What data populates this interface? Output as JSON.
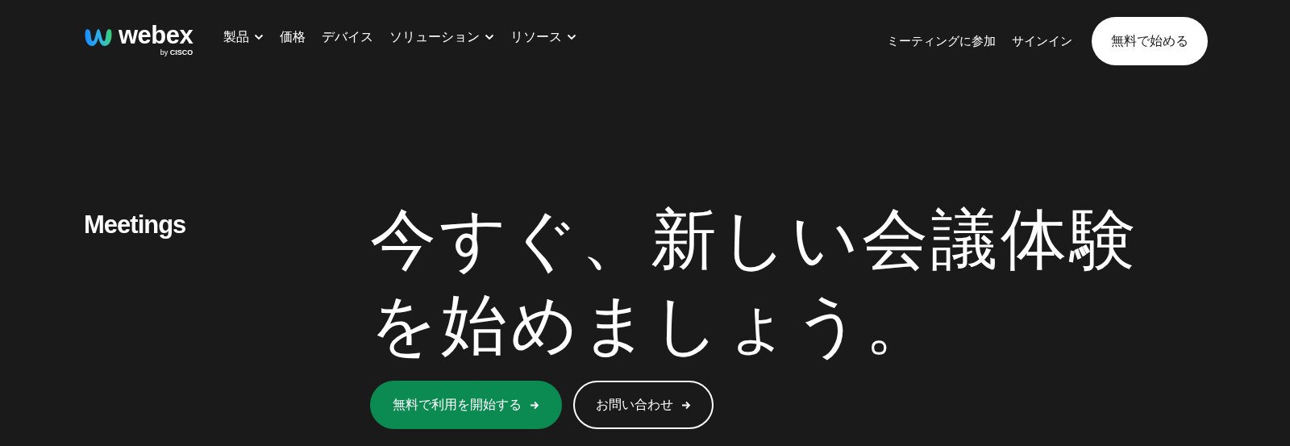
{
  "header": {
    "logo": {
      "name": "webex",
      "tagline": "by **CISCO**"
    },
    "nav": [
      {
        "label": "製品",
        "has_menu": true
      },
      {
        "label": "価格",
        "has_menu": false
      },
      {
        "label": "デバイス",
        "has_menu": false
      },
      {
        "label": "ソリューション",
        "has_menu": true
      },
      {
        "label": "リソース",
        "has_menu": true
      }
    ],
    "links": [
      "ミーティングに参加",
      "サインイン"
    ],
    "cta": "無料で始める"
  },
  "hero": {
    "eyebrow": "Meetings",
    "headline": "今すぐ、新しい会議体験を始めましょう。",
    "buttons": [
      {
        "label": "無料で利用を開始する",
        "kind": "primary"
      },
      {
        "label": "お問い合わせ",
        "kind": "outline"
      }
    ]
  }
}
